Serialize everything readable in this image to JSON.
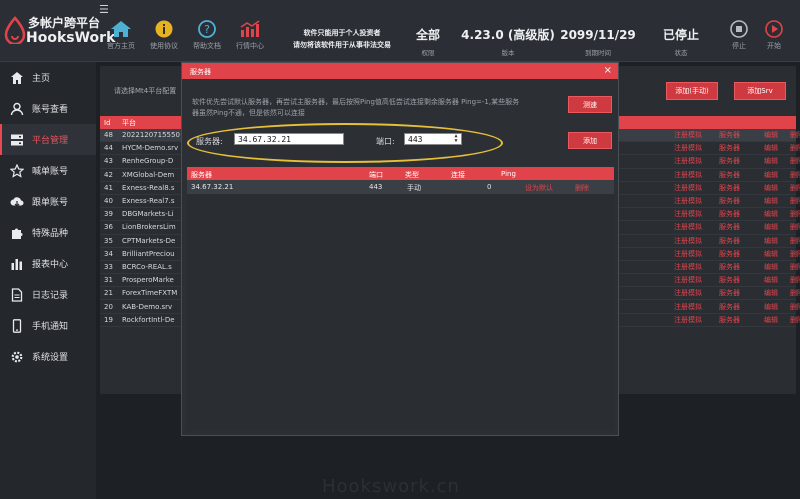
{
  "app": {
    "title_line1": "多帐户跨平台",
    "title_line2": "HooksWork",
    "menu_icon": "☰"
  },
  "toolbar": [
    {
      "label": "官方主页",
      "icon": "home-icon"
    },
    {
      "label": "使用协议",
      "icon": "info-icon"
    },
    {
      "label": "帮助文档",
      "icon": "help-icon"
    },
    {
      "label": "行情中心",
      "icon": "chart-icon"
    }
  ],
  "notice": {
    "line1": "软件只能用于个人投资者",
    "line2": "请勿将该软件用于从事非法交易"
  },
  "stats": [
    {
      "value": "全部",
      "key": "权限"
    },
    {
      "value": "4.23.0 (高级版)",
      "key": "版本"
    },
    {
      "value": "2099/11/29",
      "key": "到期时间"
    },
    {
      "value": "已停止",
      "key": "状态"
    }
  ],
  "controls": {
    "stop_label": "停止",
    "start_label": "开始"
  },
  "sidebar": {
    "items": [
      {
        "label": "主页",
        "icon": "home-icon"
      },
      {
        "label": "账号查看",
        "icon": "user-icon"
      },
      {
        "label": "平台管理",
        "icon": "server-icon",
        "active": true
      },
      {
        "label": "喊单账号",
        "icon": "star-icon"
      },
      {
        "label": "跟单账号",
        "icon": "cloud-download-icon"
      },
      {
        "label": "特殊品种",
        "icon": "puzzle-icon"
      },
      {
        "label": "报表中心",
        "icon": "bar-chart-icon"
      },
      {
        "label": "日志记录",
        "icon": "document-icon"
      },
      {
        "label": "手机通知",
        "icon": "phone-icon"
      },
      {
        "label": "系统设置",
        "icon": "gear-icon"
      }
    ]
  },
  "platform": {
    "hint": "请选择Mt4平台配置",
    "add_manual": "添加(手动)",
    "add_srv": "添加Srv",
    "headers": {
      "id": "Id",
      "platform": "平台"
    },
    "actions": [
      "注册模拟",
      "服务器",
      "编辑",
      "删除"
    ],
    "rows": [
      {
        "id": "48",
        "name": "2022120715550"
      },
      {
        "id": "44",
        "name": "HYCM-Demo.srv"
      },
      {
        "id": "43",
        "name": "RenheGroup-D"
      },
      {
        "id": "42",
        "name": "XMGlobal-Dem"
      },
      {
        "id": "41",
        "name": "Exness-Real8.s"
      },
      {
        "id": "40",
        "name": "Exness-Real7.s"
      },
      {
        "id": "39",
        "name": "DBGMarkets-Li"
      },
      {
        "id": "36",
        "name": "LionBrokersLim"
      },
      {
        "id": "35",
        "name": "CPTMarkets-De"
      },
      {
        "id": "34",
        "name": "BrilliantPreciou"
      },
      {
        "id": "33",
        "name": "BCRCo-REAL.s"
      },
      {
        "id": "31",
        "name": "ProsperoMarke"
      },
      {
        "id": "21",
        "name": "ForexTimeFXTM"
      },
      {
        "id": "20",
        "name": "KAB-Demo.srv"
      },
      {
        "id": "19",
        "name": "RockfortIntl-De"
      }
    ]
  },
  "dialog": {
    "title": "服务器",
    "close": "×",
    "hint": "软件优先尝试默认服务器，再尝试主服务器，最后按照Ping值高低尝试连接剩余服务器 Ping=-1,某些服务器虽然Ping不通，但是依然可以连接",
    "test_button": "测速",
    "add_button": "添加",
    "server_label": "服务器:",
    "server_value": "34.67.32.21",
    "port_label": "端口:",
    "port_value": "443",
    "headers": [
      "服务器",
      "端口",
      "类型",
      "连接",
      "Ping"
    ],
    "rows": [
      {
        "server": "34.67.32.21",
        "port": "443",
        "type": "手动",
        "conn": "",
        "ping": "0",
        "set_default": "设为默认",
        "delete": "删除"
      }
    ]
  },
  "watermark": "Hookswork.cn",
  "colors": {
    "accent": "#e1434a",
    "highlight": "#e6c038",
    "bg": "#1f2226"
  }
}
